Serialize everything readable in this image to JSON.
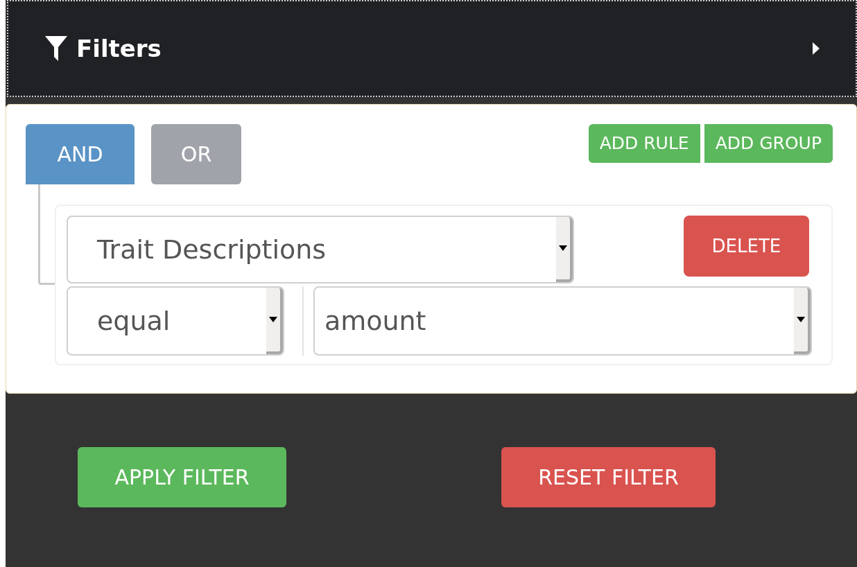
{
  "header": {
    "title": "Filters"
  },
  "conditions": [
    {
      "label": "AND",
      "selected": true
    },
    {
      "label": "OR",
      "selected": false
    }
  ],
  "group_actions": [
    "ADD RULE",
    "ADD GROUP"
  ],
  "rule": {
    "field": "Trait Descriptions",
    "operator": "equal",
    "value": "amount",
    "delete": "DELETE"
  },
  "footer_buttons": [
    {
      "label": "APPLY FILTER",
      "kind": "apply"
    },
    {
      "label": "RESET FILTER",
      "kind": "reset"
    }
  ]
}
